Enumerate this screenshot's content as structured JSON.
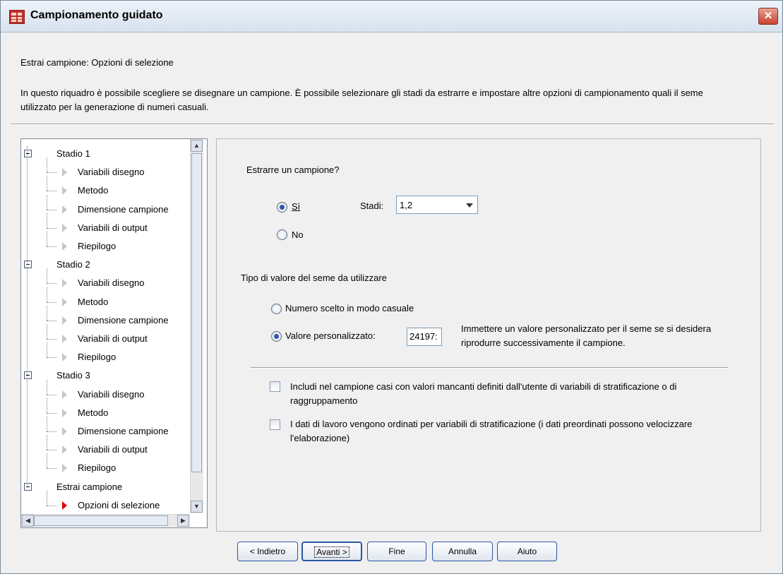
{
  "window": {
    "title": "Campionamento guidato",
    "close_label": "✕"
  },
  "header": {
    "title": "Estrai campione: Opzioni di selezione",
    "description": "In questo riquadro è possibile scegliere se disegnare un campione. È possibile selezionare gli stadi da estrarre e impostare altre opzioni di campionamento quali il seme utilizzato per la generazione di numeri casuali."
  },
  "tree": {
    "nodes": [
      {
        "label": "Stadio 1",
        "level": 0
      },
      {
        "label": "Variabili disegno",
        "level": 1
      },
      {
        "label": "Metodo",
        "level": 1
      },
      {
        "label": "Dimensione campione",
        "level": 1
      },
      {
        "label": "Variabili di output",
        "level": 1
      },
      {
        "label": "Riepilogo",
        "level": 1
      },
      {
        "label": "Stadio 2",
        "level": 0
      },
      {
        "label": "Variabili disegno",
        "level": 1
      },
      {
        "label": "Metodo",
        "level": 1
      },
      {
        "label": "Dimensione campione",
        "level": 1
      },
      {
        "label": "Variabili di output",
        "level": 1
      },
      {
        "label": "Riepilogo",
        "level": 1
      },
      {
        "label": "Stadio 3",
        "level": 0
      },
      {
        "label": "Variabili disegno",
        "level": 1
      },
      {
        "label": "Metodo",
        "level": 1
      },
      {
        "label": "Dimensione campione",
        "level": 1
      },
      {
        "label": "Variabili di output",
        "level": 1
      },
      {
        "label": "Riepilogo",
        "level": 1
      },
      {
        "label": "Estrai campione",
        "level": 0
      },
      {
        "label": "Opzioni di selezione",
        "level": 1,
        "active": true
      }
    ]
  },
  "options": {
    "draw_question": "Estrarre un campione?",
    "yes_label": "Sì",
    "no_label": "No",
    "stages_label": "Stadi:",
    "stages_value": "1,2",
    "seed_question": "Tipo di valore del seme da utilizzare",
    "random_seed_label": "Numero scelto in modo casuale",
    "custom_seed_label": "Valore personalizzato:",
    "custom_seed_value": "24197:",
    "custom_seed_help": "Immettere un valore personalizzato per il seme se si desidera riprodurre successivamente il campione.",
    "include_missing_label": "Includi nel campione  casi con valori mancanti definiti dall'utente di variabili di stratificazione o di raggruppamento",
    "presorted_label": "I dati di lavoro vengono ordinati per variabili di stratificazione (i dati preordinati possono velocizzare l'elaborazione)"
  },
  "buttons": {
    "back": "< Indietro",
    "next": "Avanti >",
    "finish": "Fine",
    "cancel": "Annulla",
    "help": "Aiuto"
  },
  "colors": {
    "active_arrow": "#e00000",
    "button_border": "#2a56a6"
  }
}
